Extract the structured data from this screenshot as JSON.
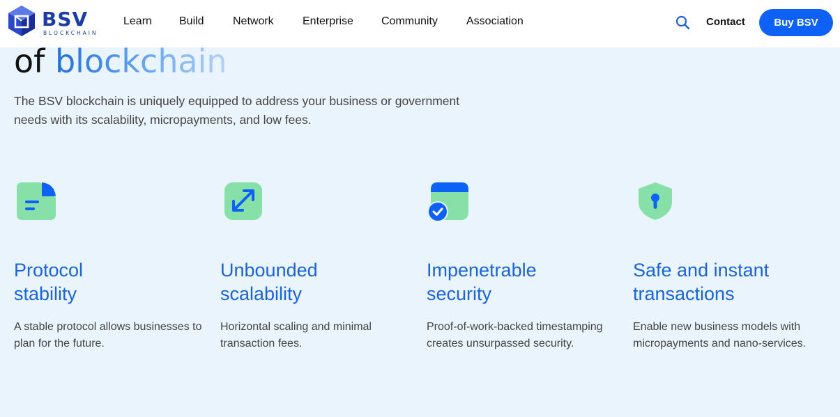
{
  "header": {
    "logo_text": "BSV",
    "logo_subtext": "BLOCKCHAIN",
    "nav": [
      "Learn",
      "Build",
      "Network",
      "Enterprise",
      "Community",
      "Association"
    ],
    "contact_label": "Contact",
    "buy_label": "Buy BSV",
    "search_icon": "search-icon"
  },
  "hero": {
    "title_dark": "of",
    "title_gradient": "blockchain",
    "lead": "The BSV blockchain is uniquely equipped to address your business or government needs with its scalability, micropayments, and low fees."
  },
  "features": [
    {
      "icon": "document-icon",
      "title": "Protocol stability",
      "title_line1": "Protocol",
      "title_line2": "stability",
      "text": "A stable protocol allows businesses to plan for the future."
    },
    {
      "icon": "expand-arrows-icon",
      "title": "Unbounded scalability",
      "title_line1": "Unbounded",
      "title_line2": "scalability",
      "text": "Horizontal scaling and minimal transaction fees."
    },
    {
      "icon": "calendar-check-icon",
      "title": "Impenetrable security",
      "title_line1": "Impenetrable",
      "title_line2": "security",
      "text": "Proof-of-work-backed timestamping creates unsurpassed security."
    },
    {
      "icon": "shield-lock-icon",
      "title": "Safe and instant transactions",
      "title_line1": "Safe and instant",
      "title_line2": "transactions",
      "text": "Enable new business models with micropayments and nano-services."
    }
  ],
  "colors": {
    "accent": "#0d62f5",
    "heading": "#1a63d8",
    "icon_green": "#86e0a8",
    "background": "#eaf4fd"
  }
}
